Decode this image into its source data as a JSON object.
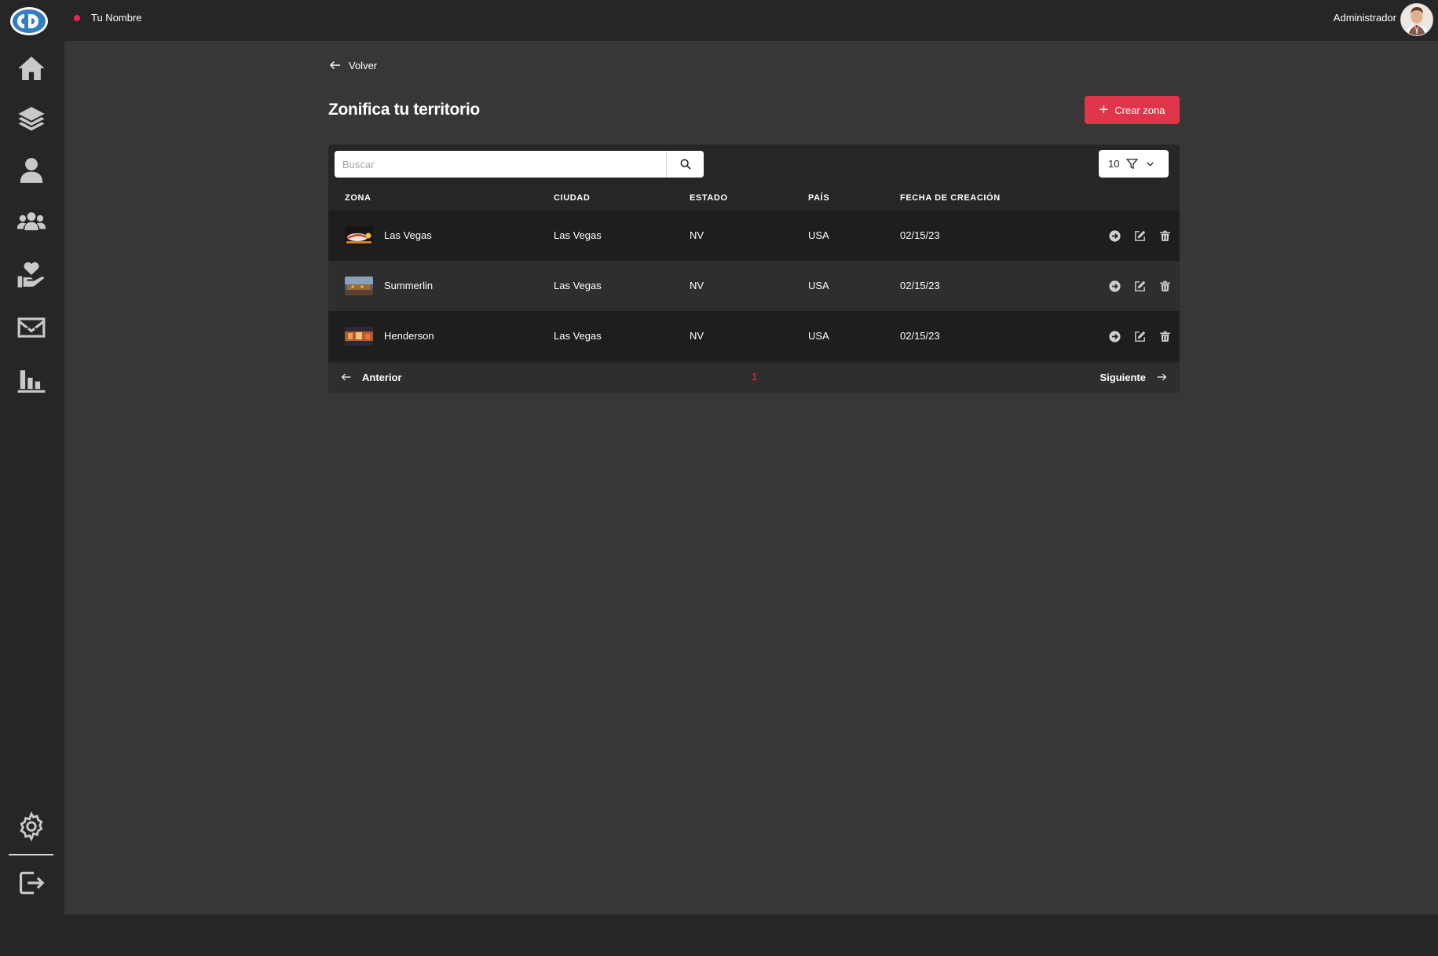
{
  "header": {
    "user_name": "Tu Nombre",
    "role": "Administrador"
  },
  "colors": {
    "accent": "#e0344a",
    "status_dot": "#e8245a",
    "background": "#373737",
    "chrome": "#262626"
  },
  "sidebar": {
    "items": [
      {
        "icon": "home-icon"
      },
      {
        "icon": "layers-icon"
      },
      {
        "icon": "user-icon"
      },
      {
        "icon": "users-group-icon"
      },
      {
        "icon": "heart-hand-icon"
      },
      {
        "icon": "mail-icon"
      },
      {
        "icon": "bar-chart-icon"
      }
    ],
    "bottom": [
      {
        "icon": "gear-icon"
      },
      {
        "icon": "logout-icon"
      }
    ]
  },
  "main": {
    "back_label": "Volver",
    "title": "Zonifica tu territorio",
    "create_label": "Crear zona",
    "search": {
      "placeholder": "Buscar",
      "value": ""
    },
    "page_size": "10",
    "columns": [
      "ZONA",
      "CIUDAD",
      "ESTADO",
      "PAÍS",
      "FECHA DE CREACIÓN"
    ],
    "rows": [
      {
        "zona": "Las Vegas",
        "ciudad": "Las Vegas",
        "estado": "NV",
        "pais": "USA",
        "fecha": "02/15/23"
      },
      {
        "zona": "Summerlin",
        "ciudad": "Las Vegas",
        "estado": "NV",
        "pais": "USA",
        "fecha": "02/15/23"
      },
      {
        "zona": "Henderson",
        "ciudad": "Las Vegas",
        "estado": "NV",
        "pais": "USA",
        "fecha": "02/15/23"
      }
    ],
    "pagination": {
      "prev": "Anterior",
      "current": "1",
      "next": "Siguiente"
    }
  }
}
